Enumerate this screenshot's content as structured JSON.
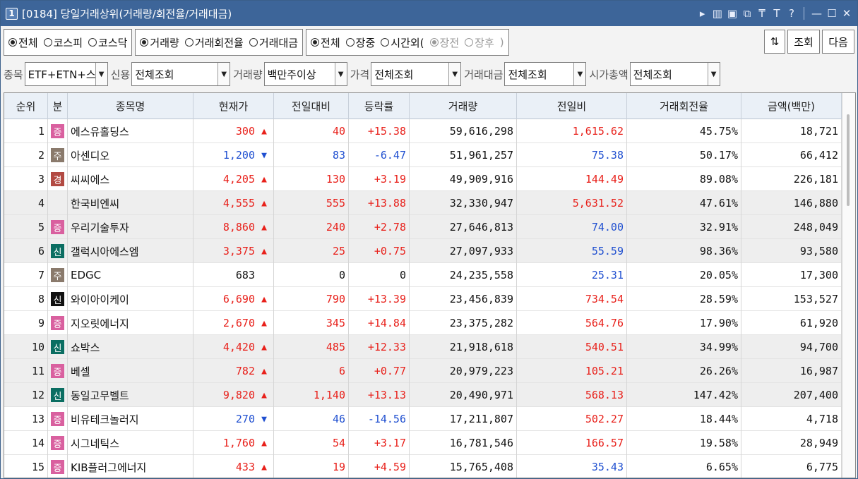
{
  "window": {
    "number": "1",
    "title": "[0184] 당일거래상위(거래량/회전율/거래대금)",
    "tools": [
      "▸",
      "▥",
      "▣",
      "⧉",
      "₸",
      "T",
      "?",
      "—",
      "☐",
      "✕"
    ]
  },
  "options": {
    "market": {
      "items": [
        "전체",
        "코스피",
        "코스닥"
      ],
      "selected": 0
    },
    "sort": {
      "items": [
        "거래량",
        "거래회전율",
        "거래대금"
      ],
      "selected": 0
    },
    "session": {
      "items": [
        "전체",
        "장중",
        "시간외("
      ],
      "selected": 0
    },
    "afterhours": {
      "items": [
        "장전",
        "장후"
      ],
      "selected": 0,
      "close": ")"
    }
  },
  "buttons": {
    "refresh_icon": "⇅",
    "query": "조회",
    "next": "다음"
  },
  "filters": [
    {
      "label": "종목",
      "value": "ETF+ETN+스"
    },
    {
      "label": "신용",
      "value": "전체조회"
    },
    {
      "label": "거래량",
      "value": "백만주이상"
    },
    {
      "label": "가격",
      "value": "전체조회"
    },
    {
      "label": "거래대금",
      "value": "전체조회"
    },
    {
      "label": "시가총액",
      "value": "전체조회"
    }
  ],
  "columns": [
    "순위",
    "분",
    "종목명",
    "현재가",
    "전일대비",
    "등락률",
    "거래량",
    "전일비",
    "거래회전율",
    "금액(백만)"
  ],
  "badge_colors": {
    "증": "#d9609f",
    "주": "#8a7a6c",
    "경": "#b24a43",
    "신": "#0b6e62",
    "신k": "#111111"
  },
  "rows": [
    {
      "rank": "1",
      "badge": "증",
      "badge_color": "#d9609f",
      "name": "에스유홀딩스",
      "price": "300",
      "dir": "up",
      "change": "40",
      "rate": "+15.38",
      "volume": "59,616,298",
      "vol_ratio": "1,615.62",
      "ratio_dir": "up",
      "turnover": "45.75%",
      "amount": "18,721"
    },
    {
      "rank": "2",
      "badge": "주",
      "badge_color": "#8a7a6c",
      "name": "아센디오",
      "price": "1,200",
      "dir": "dn",
      "change": "83",
      "rate": "-6.47",
      "volume": "51,961,257",
      "vol_ratio": "75.38",
      "ratio_dir": "dn",
      "turnover": "50.17%",
      "amount": "66,412"
    },
    {
      "rank": "3",
      "badge": "경",
      "badge_color": "#b24a43",
      "name": "씨씨에스",
      "price": "4,205",
      "dir": "up",
      "change": "130",
      "rate": "+3.19",
      "volume": "49,909,916",
      "vol_ratio": "144.49",
      "ratio_dir": "up",
      "turnover": "89.08%",
      "amount": "226,181"
    },
    {
      "rank": "4",
      "badge": "",
      "badge_color": "",
      "name": "한국비엔씨",
      "price": "4,555",
      "dir": "up",
      "change": "555",
      "rate": "+13.88",
      "volume": "32,330,947",
      "vol_ratio": "5,631.52",
      "ratio_dir": "up",
      "turnover": "47.61%",
      "amount": "146,880"
    },
    {
      "rank": "5",
      "badge": "증",
      "badge_color": "#d9609f",
      "name": "우리기술투자",
      "price": "8,860",
      "dir": "up",
      "change": "240",
      "rate": "+2.78",
      "volume": "27,646,813",
      "vol_ratio": "74.00",
      "ratio_dir": "dn",
      "turnover": "32.91%",
      "amount": "248,049"
    },
    {
      "rank": "6",
      "badge": "신",
      "badge_color": "#0b6e62",
      "name": "갤럭시아에스엠",
      "price": "3,375",
      "dir": "up",
      "change": "25",
      "rate": "+0.75",
      "volume": "27,097,933",
      "vol_ratio": "55.59",
      "ratio_dir": "dn",
      "turnover": "98.36%",
      "amount": "93,580"
    },
    {
      "rank": "7",
      "badge": "주",
      "badge_color": "#8a7a6c",
      "name": "EDGC",
      "price": "683",
      "dir": "flat",
      "change": "0",
      "rate": "0",
      "volume": "24,235,558",
      "vol_ratio": "25.31",
      "ratio_dir": "dn",
      "turnover": "20.05%",
      "amount": "17,300"
    },
    {
      "rank": "8",
      "badge": "신",
      "badge_color": "#111111",
      "name": "와이아이케이",
      "price": "6,690",
      "dir": "up",
      "change": "790",
      "rate": "+13.39",
      "volume": "23,456,839",
      "vol_ratio": "734.54",
      "ratio_dir": "up",
      "turnover": "28.59%",
      "amount": "153,527"
    },
    {
      "rank": "9",
      "badge": "증",
      "badge_color": "#d9609f",
      "name": "지오릿에너지",
      "price": "2,670",
      "dir": "up",
      "change": "345",
      "rate": "+14.84",
      "volume": "23,375,282",
      "vol_ratio": "564.76",
      "ratio_dir": "up",
      "turnover": "17.90%",
      "amount": "61,920"
    },
    {
      "rank": "10",
      "badge": "신",
      "badge_color": "#0b6e62",
      "name": "쇼박스",
      "price": "4,420",
      "dir": "up",
      "change": "485",
      "rate": "+12.33",
      "volume": "21,918,618",
      "vol_ratio": "540.51",
      "ratio_dir": "up",
      "turnover": "34.99%",
      "amount": "94,700"
    },
    {
      "rank": "11",
      "badge": "증",
      "badge_color": "#d9609f",
      "name": "베셀",
      "price": "782",
      "dir": "up",
      "change": "6",
      "rate": "+0.77",
      "volume": "20,979,223",
      "vol_ratio": "105.21",
      "ratio_dir": "up",
      "turnover": "26.26%",
      "amount": "16,987"
    },
    {
      "rank": "12",
      "badge": "신",
      "badge_color": "#0b6e62",
      "name": "동일고무벨트",
      "price": "9,820",
      "dir": "up",
      "change": "1,140",
      "rate": "+13.13",
      "volume": "20,490,971",
      "vol_ratio": "568.13",
      "ratio_dir": "up",
      "turnover": "147.42%",
      "amount": "207,400"
    },
    {
      "rank": "13",
      "badge": "증",
      "badge_color": "#d9609f",
      "name": "비유테크놀러지",
      "price": "270",
      "dir": "dn",
      "change": "46",
      "rate": "-14.56",
      "volume": "17,211,807",
      "vol_ratio": "502.27",
      "ratio_dir": "up",
      "turnover": "18.44%",
      "amount": "4,718"
    },
    {
      "rank": "14",
      "badge": "증",
      "badge_color": "#d9609f",
      "name": "시그네틱스",
      "price": "1,760",
      "dir": "up",
      "change": "54",
      "rate": "+3.17",
      "volume": "16,781,546",
      "vol_ratio": "166.57",
      "ratio_dir": "up",
      "turnover": "19.58%",
      "amount": "28,949"
    },
    {
      "rank": "15",
      "badge": "증",
      "badge_color": "#d9609f",
      "name": "KIB플러그에너지",
      "price": "433",
      "dir": "up",
      "change": "19",
      "rate": "+4.59",
      "volume": "15,765,408",
      "vol_ratio": "35.43",
      "ratio_dir": "dn",
      "turnover": "6.65%",
      "amount": "6,775"
    }
  ],
  "alt_rows": [
    4,
    5,
    6,
    10,
    11,
    12
  ]
}
